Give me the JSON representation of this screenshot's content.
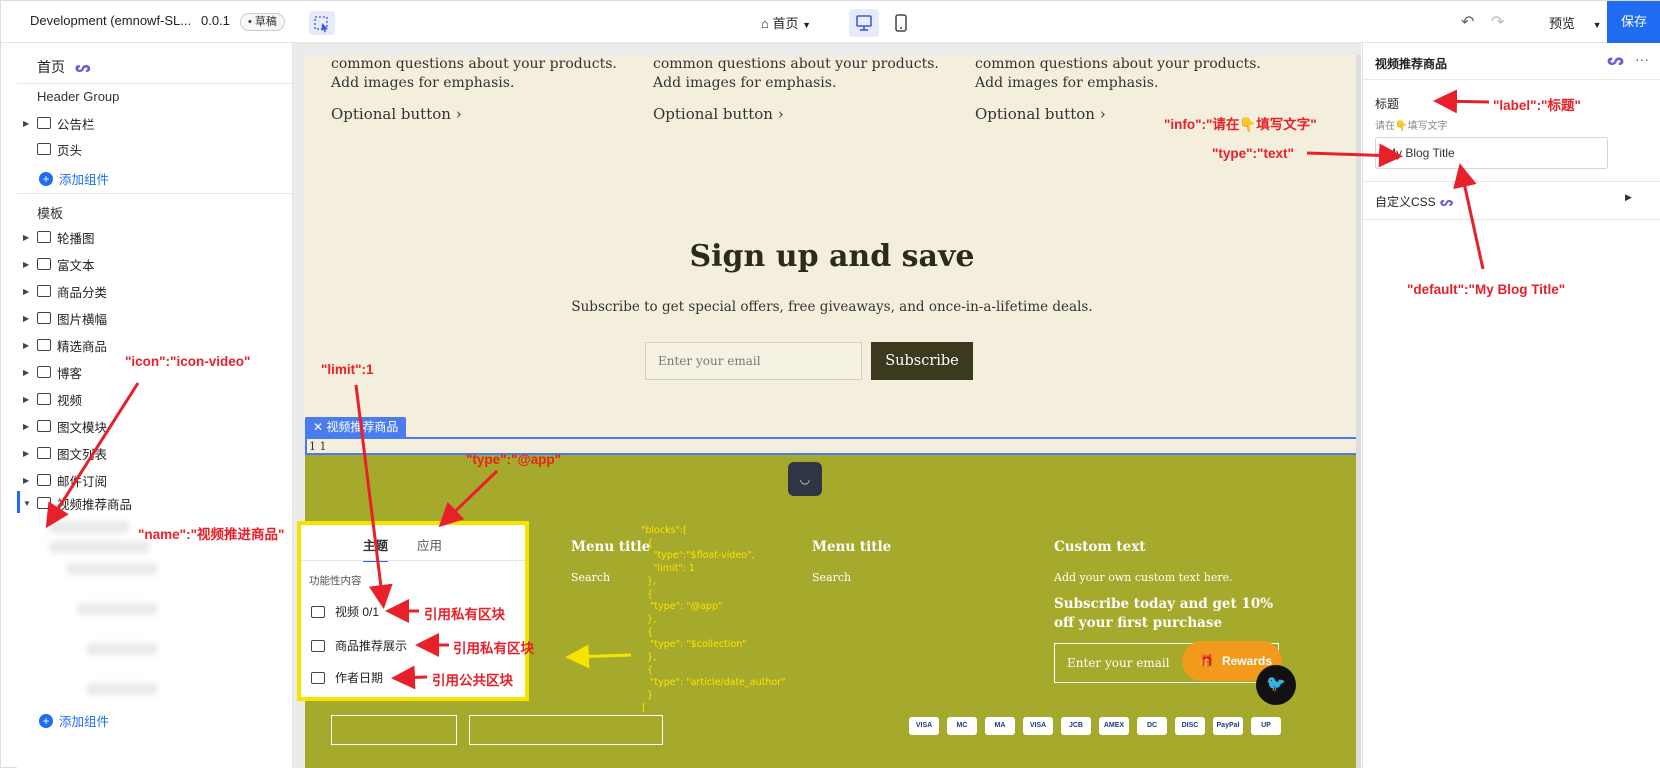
{
  "topbar": {
    "app_title": "Development (emnowf-SL...",
    "version": "0.0.1",
    "draft": "草稿",
    "page": "首页",
    "preview": "预览",
    "save": "保存"
  },
  "left": {
    "home": "首页",
    "header_group": "Header Group",
    "header_items": [
      "公告栏",
      "页头"
    ],
    "add_component": "添加组件",
    "template": "模板",
    "template_items": [
      "轮播图",
      "富文本",
      "商品分类",
      "图片横幅",
      "精选商品",
      "博客",
      "视频",
      "图文模块",
      "图文列表",
      "邮件订阅",
      "视频推荐商品"
    ]
  },
  "canvas": {
    "col_text": "common questions about your products. Add images for emphasis.",
    "optional_button": "Optional button ›",
    "signup_title": "Sign up and save",
    "signup_sub": "Subscribe to get special offers, free giveaways, and once-in-a-lifetime deals.",
    "email_placeholder": "Enter your email",
    "subscribe": "Subscribe",
    "selected_tag": "✕  视频推荐商品",
    "selected_text": "1 1",
    "footer": {
      "menu_title": "Menu title",
      "search": "Search",
      "custom_title": "Custom text",
      "custom_text": "Add your own custom text here.",
      "promo": "Subscribe today and get 10% off your first purchase",
      "email_placeholder": "Enter your email",
      "rewards": "Rewards",
      "cards": [
        "VISA",
        "MC",
        "MA",
        "VISA",
        "JCB",
        "AMEX",
        "DC",
        "DISC",
        "PayPal",
        "UP"
      ]
    }
  },
  "popup": {
    "tab_theme": "主题",
    "tab_app": "应用",
    "section": "功能性内容",
    "items": [
      "视频 0/1",
      "商品推荐展示",
      "作者日期"
    ]
  },
  "json_overlay": "\"blocks\":[\n  {\n    \"type\":\"$float-video\",\n    \"limit\": 1\n  },\n  {\n   \"type\": \"@app\"\n  },\n  {\n   \"type\": \"$collection\"\n  },\n  {\n   \"type\": \"article/date_author\"\n  }\n]",
  "right": {
    "title": "视频推荐商品",
    "label": "标题",
    "info": "请在👇填写文字",
    "input_value": "My Blog Title",
    "custom_css": "自定义CSS"
  },
  "annotations": {
    "label": "\"label\":\"标题\"",
    "info": "\"info\":\"请在👇填写文字\"",
    "type_text": "\"type\":\"text\"",
    "default": "\"default\":\"My Blog Title\"",
    "icon": "\"icon\":\"icon-video\"",
    "limit": "\"limit\":1",
    "type_app": "\"type\":\"@app\"",
    "name": "\"name\":\"视频推进商品\"",
    "private1": "引用私有区块",
    "private2": "引用私有区块",
    "public": "引用公共区块"
  },
  "colors": {
    "accent": "#1f6cf2",
    "annotation": "#e8202a",
    "highlight": "#f4e400",
    "footer_bg": "#a6aa2c"
  }
}
